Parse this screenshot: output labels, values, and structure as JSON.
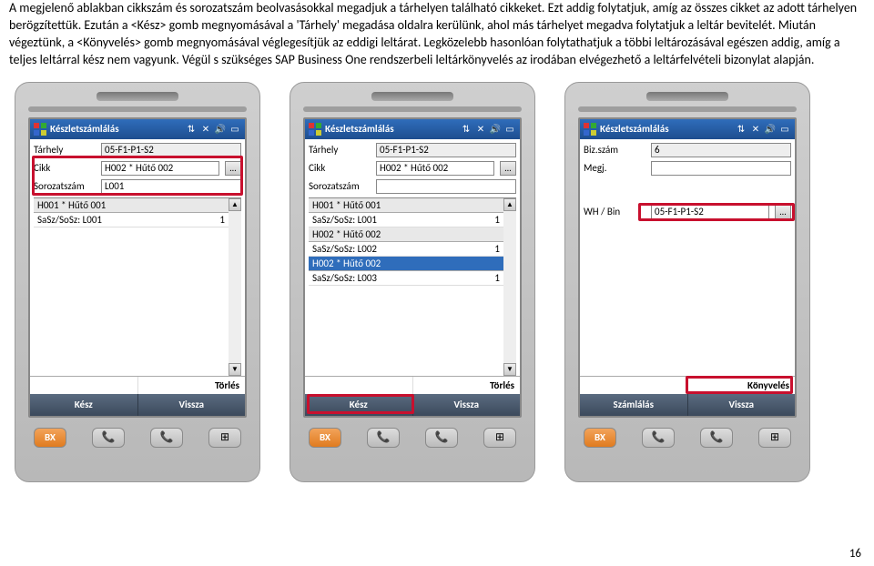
{
  "paragraph": "A megjelenő ablakban cikkszám és sorozatszám beolvasásokkal megadjuk a tárhelyen található cikkeket. Ezt addig folytatjuk, amíg az összes cikket az adott tárhelyen berögzítettük. Ezután a <Kész> gomb megnyomásával a 'Tárhely' megadása oldalra kerülünk, ahol más tárhelyet megadva folytatjuk a leltár bevitelét. Miután végeztünk, a <Könyvelés> gomb megnyomásával véglegesítjük az eddigi leltárat. Legközelebb hasonlóan folytathatjuk a többi leltározásával egészen addig, amíg a teljes leltárral kész nem vagyunk. Végül s szükséges SAP Business One rendszerbeli leltárkönyvelés az irodában elvégezhető a leltárfelvételi bizonylat alapján.",
  "titlebar": {
    "title": "Készletszámlálás",
    "icons": [
      "⇅",
      "✕",
      "🔊",
      "▭"
    ]
  },
  "device1": {
    "fields": {
      "tarhely_label": "Tárhely",
      "tarhely_value": "05-F1-P1-S2",
      "cikk_label": "Cikk",
      "cikk_value": "H002 * Hűtő 002",
      "soro_label": "Sorozatszám",
      "soro_value": "L001"
    },
    "list": [
      {
        "header": "H001 * Hűtő 001"
      },
      {
        "sub_key": "SaSz/SoSz: L001",
        "sub_val": "1"
      }
    ],
    "action_right": "Törlés",
    "bottom": {
      "left": "Kész",
      "right": "Vissza"
    }
  },
  "device2": {
    "fields": {
      "tarhely_label": "Tárhely",
      "tarhely_value": "05-F1-P1-S2",
      "cikk_label": "Cikk",
      "cikk_value": "H002 * Hűtő 002",
      "soro_label": "Sorozatszám",
      "soro_value": ""
    },
    "list": [
      {
        "header": "H001 * Hűtő 001"
      },
      {
        "sub_key": "SaSz/SoSz: L001",
        "sub_val": "1"
      },
      {
        "header": "H002 * Hűtő 002"
      },
      {
        "sub_key": "SaSz/SoSz: L002",
        "sub_val": "1"
      },
      {
        "header_hl": "H002 * Hűtő 002"
      },
      {
        "sub_key": "SaSz/SoSz: L003",
        "sub_val": "1"
      }
    ],
    "action_right": "Törlés",
    "bottom": {
      "left": "Kész",
      "right": "Vissza"
    }
  },
  "device3": {
    "fields": {
      "biz_label": "Biz.szám",
      "biz_value": "6",
      "megj_label": "Megj.",
      "megj_value": "",
      "whbin_label": "WH / Bin",
      "whbin_value": "05-F1-P1-S2"
    },
    "action_right": "Könyvelés",
    "bottom": {
      "left": "Számlálás",
      "right": "Vissza"
    }
  },
  "hw": {
    "bx": "BX",
    "call": "📞",
    "end": "📞",
    "win": "⊞"
  },
  "page_number": "16"
}
